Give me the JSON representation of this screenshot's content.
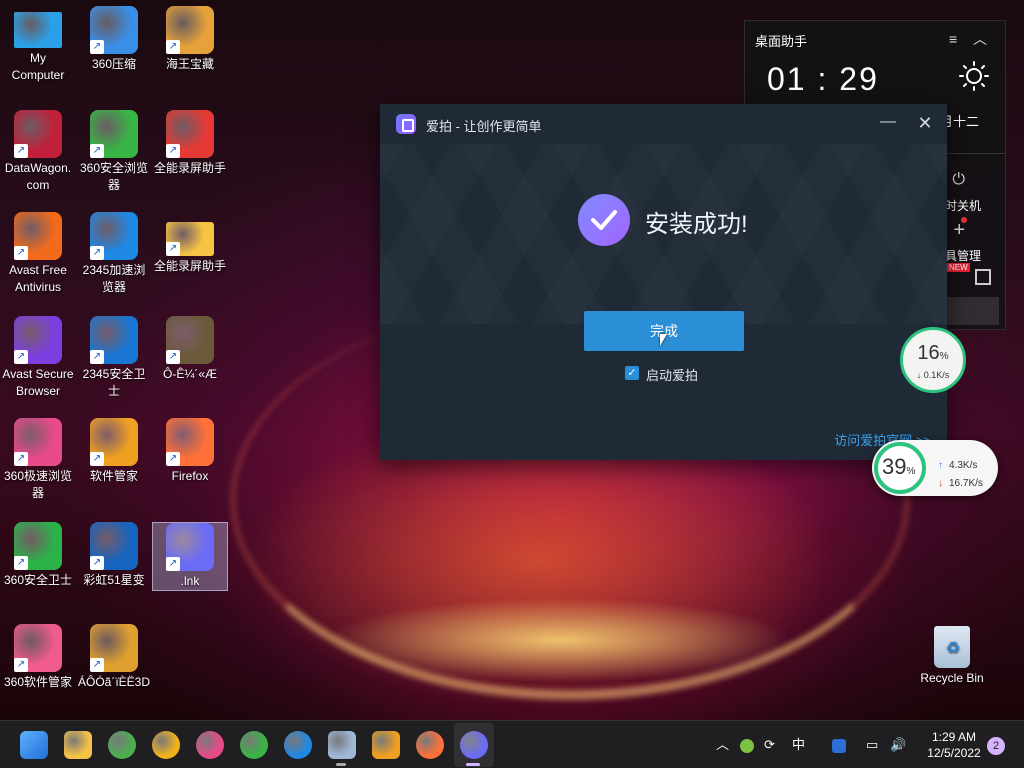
{
  "desktop": {
    "icons": [
      {
        "label": "My\nComputer",
        "icon": "computer-icon",
        "color": "#2aa0e8"
      },
      {
        "label": "360压缩",
        "icon": "zip-icon",
        "color": "#3a8ee6"
      },
      {
        "label": "海王宝藏",
        "icon": "game-icon",
        "color": "#e6a23a"
      },
      {
        "label": "DataWagon.\ncom",
        "icon": "datawagon-icon",
        "color": "#c0203a"
      },
      {
        "label": "360安全浏览\n器",
        "icon": "browser-360-icon",
        "color": "#38b544"
      },
      {
        "label": "全能录屏助手",
        "icon": "recorder-icon",
        "color": "#e53935"
      },
      {
        "label": "Avast Free\nAntivirus",
        "icon": "avast-icon",
        "color": "#f26a1b"
      },
      {
        "label": "2345加速浏\n览器",
        "icon": "ie-icon",
        "color": "#1e88e5"
      },
      {
        "label": "全能录屏助手",
        "icon": "folder-icon",
        "color": "#f6c443"
      },
      {
        "label": "Avast Secure\nBrowser",
        "icon": "avast-browser-icon",
        "color": "#7b3fe0"
      },
      {
        "label": "2345安全卫\n士",
        "icon": "shield-icon",
        "color": "#1976d2"
      },
      {
        "label": "Ô-Ê¼´«Æ",
        "icon": "dragon-game-icon",
        "color": "#6b5a3a"
      },
      {
        "label": "360极速浏览\n器",
        "icon": "browser-360-fast-icon",
        "color": "#e84a8a"
      },
      {
        "label": "软件管家",
        "icon": "software-manager-icon",
        "color": "#f0a020"
      },
      {
        "label": "Firefox",
        "icon": "firefox-icon",
        "color": "#ff7139"
      },
      {
        "label": "360安全卫士",
        "icon": "guard-360-icon",
        "color": "#2bb34a"
      },
      {
        "label": "彩虹51星变",
        "icon": "rainbow-icon",
        "color": "#1565c0"
      },
      {
        "label": ".lnk",
        "icon": "aipai-icon",
        "color": "#6b6cf5"
      },
      {
        "label": "360软件管家",
        "icon": "software-360-icon",
        "color": "#ef5b8c"
      },
      {
        "label": "ÁÔÓã´ïÈË3D",
        "icon": "fish-game-icon",
        "color": "#e0a030"
      }
    ],
    "recycle_bin": "Recycle Bin"
  },
  "widget": {
    "title": "桌面助手",
    "time": "01 : 29",
    "date_partial": "月十二",
    "shutdown_label": "时关机",
    "tools_label": "具管理",
    "new_badge": "NEW"
  },
  "installer": {
    "title": "爱拍 - 让创作更简单",
    "success_text": "安装成功!",
    "done_button": "完成",
    "launch_checkbox_label": "启动爱拍",
    "launch_checked": true,
    "visit_link": "访问爱拍官网 >>",
    "accent": "#2b8fd8"
  },
  "net_monitor_small": {
    "percent": "16",
    "unit": "%",
    "speed": "↓ 0.1K/s"
  },
  "net_monitor_large": {
    "percent": "39",
    "unit": "%",
    "upload": "4.3K/s",
    "download": "16.7K/s"
  },
  "taskbar": {
    "apps": [
      {
        "name": "start-icon",
        "color": "#3b8eea"
      },
      {
        "name": "file-explorer-icon",
        "color": "#f5c146"
      },
      {
        "name": "chrome-icon",
        "color": "#4caf50"
      },
      {
        "name": "avast-browser-icon",
        "color": "#f2b21b"
      },
      {
        "name": "browser-360-fast-icon",
        "color": "#e84a8a"
      },
      {
        "name": "browser-360-icon",
        "color": "#38b544"
      },
      {
        "name": "ie-icon",
        "color": "#1e88e5"
      },
      {
        "name": "monitor-icon",
        "color": "#9fb8d8"
      },
      {
        "name": "software-manager-icon",
        "color": "#f0a020"
      },
      {
        "name": "firefox-icon",
        "color": "#ff7139"
      },
      {
        "name": "aipai-icon",
        "color": "#6b6cf5"
      }
    ],
    "tray_ime": "中",
    "time": "1:29 AM",
    "date": "12/5/2022",
    "notifications": "2"
  }
}
